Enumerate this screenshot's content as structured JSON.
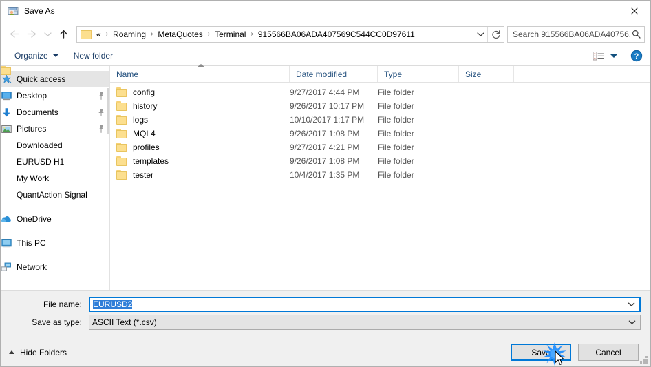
{
  "window": {
    "title": "Save As",
    "title_icon": "save-as-icon",
    "close_label": "✕"
  },
  "nav": {
    "back_icon": "back-arrow-icon",
    "forward_icon": "forward-arrow-icon",
    "recent_icon": "chevron-down-icon",
    "up_icon": "up-arrow-icon",
    "folder_icon": "folder-icon",
    "breadcrumbs": [
      "«",
      "Roaming",
      "MetaQuotes",
      "Terminal",
      "915566BA06ADA407569C544CC0D97611"
    ],
    "separator": "›",
    "dropdown_icon": "chevron-down-icon",
    "refresh_icon": "refresh-icon"
  },
  "search": {
    "placeholder": "Search 915566BA06ADA40756...",
    "icon": "search-icon"
  },
  "toolbar": {
    "organize_label": "Organize",
    "new_folder_label": "New folder",
    "view_icon": "view-options-icon",
    "help_icon": "help-icon"
  },
  "sidebar": {
    "items": [
      {
        "label": "Quick access",
        "icon": "star-pin-icon",
        "selected": true,
        "pinned": false,
        "gap_before": false
      },
      {
        "label": "Desktop",
        "icon": "desktop-icon",
        "selected": false,
        "pinned": true,
        "gap_before": false
      },
      {
        "label": "Documents",
        "icon": "documents-icon",
        "selected": false,
        "pinned": true,
        "gap_before": false
      },
      {
        "label": "Pictures",
        "icon": "pictures-icon",
        "selected": false,
        "pinned": true,
        "gap_before": false
      },
      {
        "label": "Downloaded",
        "icon": "folder-icon",
        "selected": false,
        "pinned": false,
        "gap_before": false
      },
      {
        "label": "EURUSD H1",
        "icon": "folder-icon",
        "selected": false,
        "pinned": false,
        "gap_before": false
      },
      {
        "label": "My Work",
        "icon": "folder-icon",
        "selected": false,
        "pinned": false,
        "gap_before": false
      },
      {
        "label": "QuantAction Signal",
        "icon": "folder-icon",
        "selected": false,
        "pinned": false,
        "gap_before": false
      },
      {
        "label": "OneDrive",
        "icon": "onedrive-icon",
        "selected": false,
        "pinned": false,
        "gap_before": true
      },
      {
        "label": "This PC",
        "icon": "this-pc-icon",
        "selected": false,
        "pinned": false,
        "gap_before": true
      },
      {
        "label": "Network",
        "icon": "network-icon",
        "selected": false,
        "pinned": false,
        "gap_before": true
      }
    ],
    "pin_icon": "pin-icon"
  },
  "filelist": {
    "columns": [
      "Name",
      "Date modified",
      "Type",
      "Size"
    ],
    "sort_column": "Name",
    "sort_direction": "ascending",
    "rows": [
      {
        "name": "config",
        "date": "9/27/2017 4:44 PM",
        "type": "File folder",
        "size": ""
      },
      {
        "name": "history",
        "date": "9/26/2017 10:17 PM",
        "type": "File folder",
        "size": ""
      },
      {
        "name": "logs",
        "date": "10/10/2017 1:17 PM",
        "type": "File folder",
        "size": ""
      },
      {
        "name": "MQL4",
        "date": "9/26/2017 1:08 PM",
        "type": "File folder",
        "size": ""
      },
      {
        "name": "profiles",
        "date": "9/27/2017 4:21 PM",
        "type": "File folder",
        "size": ""
      },
      {
        "name": "templates",
        "date": "9/26/2017 1:08 PM",
        "type": "File folder",
        "size": ""
      },
      {
        "name": "tester",
        "date": "10/4/2017 1:35 PM",
        "type": "File folder",
        "size": ""
      }
    ]
  },
  "form": {
    "file_name_label": "File name:",
    "file_name_value": "EURUSD2",
    "save_as_type_label": "Save as type:",
    "save_as_type_value": "ASCII Text (*.csv)",
    "dropdown_icon": "chevron-down-icon"
  },
  "footer": {
    "hide_folders_label": "Hide Folders",
    "save_label": "Save",
    "cancel_label": "Cancel"
  },
  "colors": {
    "accent": "#0078d7",
    "folder": "#fcdf8f",
    "link_text": "#1a3c66",
    "selection": "#2f7ed8",
    "click_burst": "#1a8cff"
  }
}
